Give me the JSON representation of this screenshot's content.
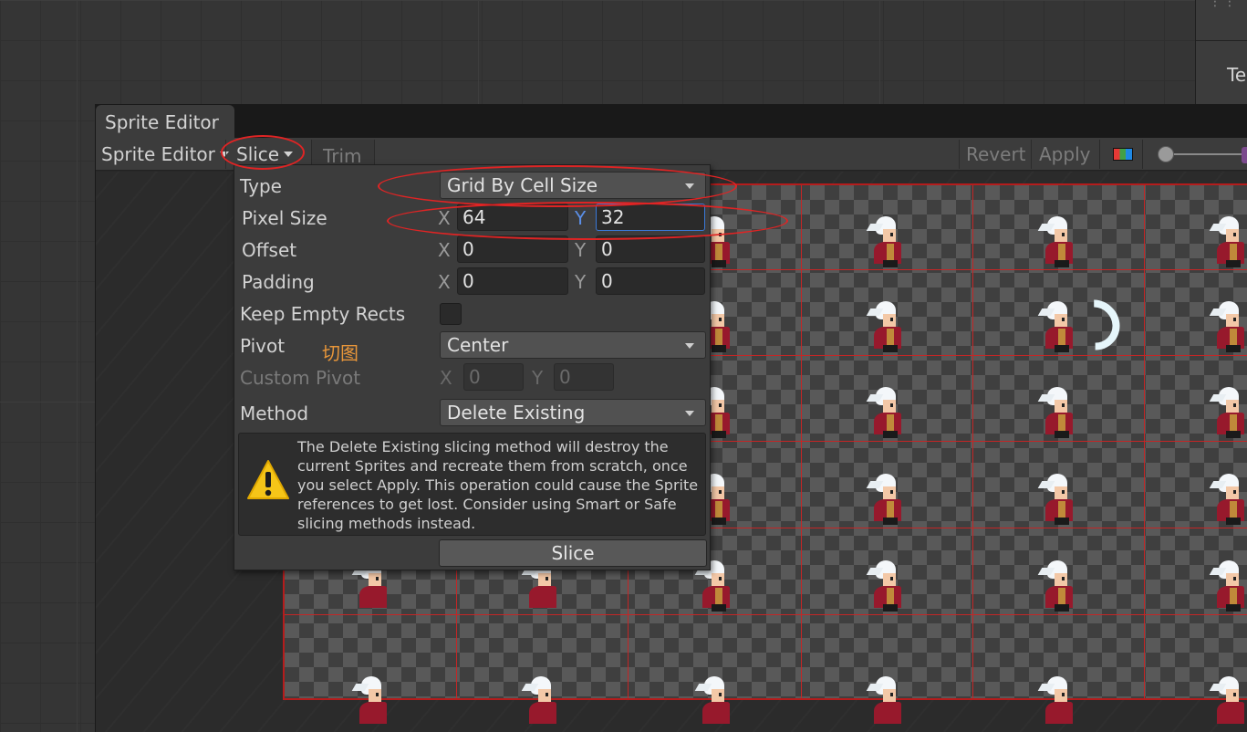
{
  "inspector": {
    "partial_label": "Te"
  },
  "editor": {
    "tab_title": "Sprite Editor",
    "toolbar": {
      "mode_dropdown": "Sprite Editor",
      "slice_menu": "Slice",
      "trim": "Trim",
      "revert": "Revert",
      "apply": "Apply"
    }
  },
  "slice_panel": {
    "type_label": "Type",
    "type_value": "Grid By Cell Size",
    "pixel_size_label": "Pixel Size",
    "pixel_size": {
      "x_axis": "X",
      "y_axis": "Y",
      "x": "64",
      "y": "32"
    },
    "offset_label": "Offset",
    "offset": {
      "x_axis": "X",
      "y_axis": "Y",
      "x": "0",
      "y": "0"
    },
    "padding_label": "Padding",
    "padding": {
      "x_axis": "X",
      "y_axis": "Y",
      "x": "0",
      "y": "0"
    },
    "keep_empty_label": "Keep Empty Rects",
    "keep_empty_checked": false,
    "pivot_label": "Pivot",
    "pivot_value": "Center",
    "annotation_note": "切图",
    "custom_pivot_label": "Custom Pivot",
    "custom_pivot": {
      "x_axis": "X",
      "y_axis": "Y",
      "x": "0",
      "y": "0"
    },
    "method_label": "Method",
    "method_value": "Delete Existing",
    "warning_text": "The Delete Existing slicing method will destroy the current Sprites and recreate them from scratch, once you select Apply. This operation could cause the Sprite references to get lost. Consider using Smart or Safe slicing methods instead.",
    "slice_button": "Slice"
  },
  "colors": {
    "annotation_red": "#e02424",
    "grid_red": "#c42626",
    "focus_blue": "#3a79d9",
    "note_orange": "#e8963a"
  }
}
